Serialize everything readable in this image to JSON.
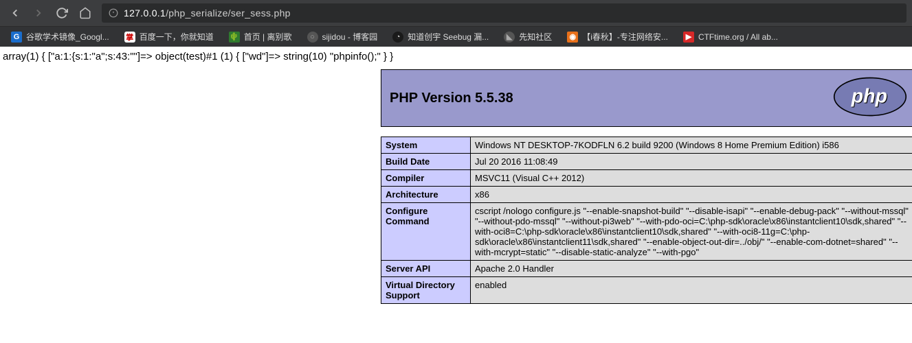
{
  "url": {
    "scheme": "127.0.0.1",
    "path": "/php_serialize/ser_sess.php"
  },
  "bookmarks": [
    {
      "label": "谷歌学术镜像_Googl...",
      "icon": "G",
      "iconClass": "bm-blue"
    },
    {
      "label": "百度一下，你就知道",
      "icon": "掌",
      "iconClass": "bm-white"
    },
    {
      "label": "首页 | 离别歌",
      "icon": "🌵",
      "iconClass": "bm-green"
    },
    {
      "label": "sijidou - 博客园",
      "icon": "○",
      "iconClass": "bm-gray"
    },
    {
      "label": "知道创宇 Seebug 漏...",
      "icon": "◔",
      "iconClass": "bm-dark"
    },
    {
      "label": "先知社区",
      "icon": "◣",
      "iconClass": "bm-gray"
    },
    {
      "label": "【i春秋】-专注网络安...",
      "icon": "◉",
      "iconClass": "bm-orange"
    },
    {
      "label": "CTFtime.org / All ab...",
      "icon": "▶",
      "iconClass": "bm-red"
    }
  ],
  "page": {
    "output": "array(1) { [\"a:1:{s:1:\"a\";s:43:\"\"]=> object(test)#1 (1) { [\"wd\"]=> string(10) \"phpinfo();\" } }",
    "phpinfo": {
      "title": "PHP Version 5.5.38",
      "rows": [
        {
          "key": "System",
          "val": "Windows NT DESKTOP-7KODFLN 6.2 build 9200 (Windows 8 Home Premium Edition) i586"
        },
        {
          "key": "Build Date",
          "val": "Jul 20 2016 11:08:49"
        },
        {
          "key": "Compiler",
          "val": "MSVC11 (Visual C++ 2012)"
        },
        {
          "key": "Architecture",
          "val": "x86"
        },
        {
          "key": "Configure Command",
          "val": "cscript /nologo configure.js \"--enable-snapshot-build\" \"--disable-isapi\" \"--enable-debug-pack\" \"--without-mssql\" \"--without-pdo-mssql\" \"--without-pi3web\" \"--with-pdo-oci=C:\\php-sdk\\oracle\\x86\\instantclient10\\sdk,shared\" \"--with-oci8=C:\\php-sdk\\oracle\\x86\\instantclient10\\sdk,shared\" \"--with-oci8-11g=C:\\php-sdk\\oracle\\x86\\instantclient11\\sdk,shared\" \"--enable-object-out-dir=../obj/\" \"--enable-com-dotnet=shared\" \"--with-mcrypt=static\" \"--disable-static-analyze\" \"--with-pgo\""
        },
        {
          "key": "Server API",
          "val": "Apache 2.0 Handler"
        },
        {
          "key": "Virtual Directory Support",
          "val": "enabled"
        }
      ]
    }
  }
}
